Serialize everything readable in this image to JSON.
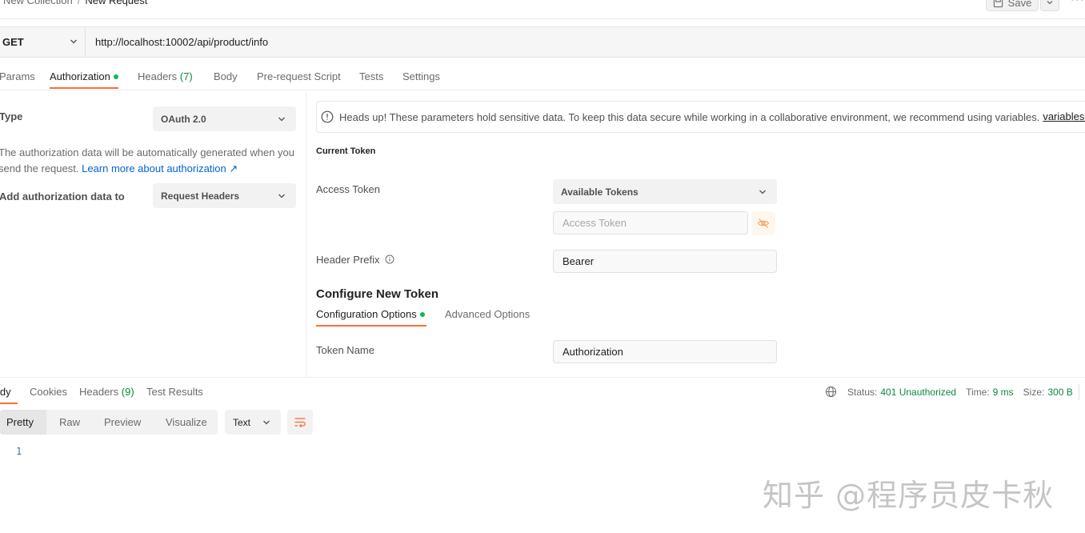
{
  "breadcrumb": {
    "parent": "New Collection",
    "separator": "/",
    "current": "New Request"
  },
  "header": {
    "save_label": "Save"
  },
  "request": {
    "method": "GET",
    "url": "http://localhost:10002/api/product/info"
  },
  "request_tabs": {
    "params": "Params",
    "authorization": "Authorization",
    "headers": "Headers",
    "headers_count": "(7)",
    "body": "Body",
    "pre_request": "Pre-request Script",
    "tests": "Tests",
    "settings": "Settings"
  },
  "auth": {
    "type_label": "Type",
    "type_value": "OAuth 2.0",
    "description": "The authorization data will be automatically generated when you send the request.",
    "learn_more": "Learn more about authorization ↗",
    "add_to_label": "Add authorization data to",
    "add_to_value": "Request Headers"
  },
  "banner": {
    "text": "Heads up! These parameters hold sensitive data. To keep this data secure while working in a collaborative environment, we recommend using variables.",
    "link": "variables ↗"
  },
  "current_token": {
    "title": "Current Token",
    "access_token_label": "Access Token",
    "available_tokens": "Available Tokens",
    "access_token_placeholder": "Access Token",
    "header_prefix_label": "Header Prefix",
    "header_prefix_value": "Bearer"
  },
  "configure": {
    "title": "Configure New Token",
    "tab_config": "Configuration Options",
    "tab_advanced": "Advanced Options",
    "token_name_label": "Token Name",
    "token_name_value": "Authorization"
  },
  "response": {
    "tab_body": "Body",
    "tab_cookies": "Cookies",
    "tab_headers": "Headers",
    "headers_count": "(9)",
    "tab_tests": "Test Results",
    "status_label": "Status:",
    "status_value": "401 Unauthorized",
    "time_label": "Time:",
    "time_value": "9 ms",
    "size_label": "Size:",
    "size_value": "300 B",
    "formats": {
      "pretty": "Pretty",
      "raw": "Raw",
      "preview": "Preview",
      "visualize": "Visualize"
    },
    "language": "Text",
    "line_number": "1"
  },
  "watermark": "知乎 @程序员皮卡秋",
  "colors": {
    "accent": "#ff6c37",
    "success": "#0cbb52",
    "link": "#0265d2"
  }
}
